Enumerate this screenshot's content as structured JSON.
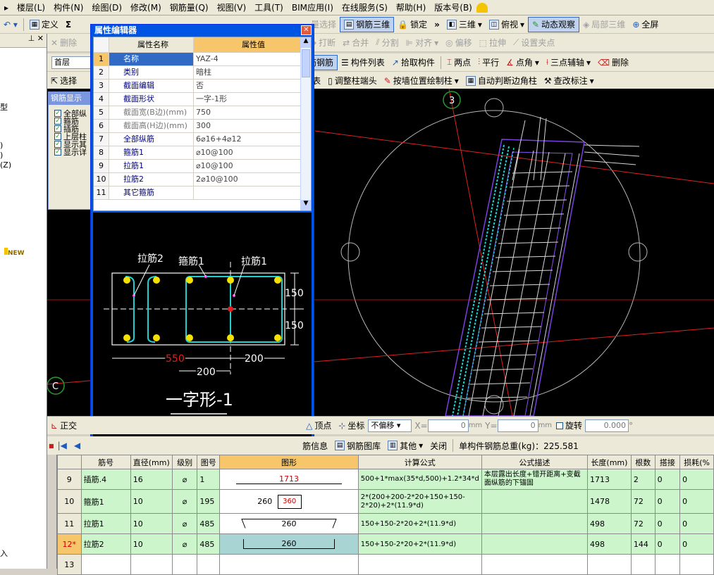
{
  "menubar": [
    "楼层(L)",
    "构件(N)",
    "绘图(D)",
    "修改(M)",
    "钢筋量(Q)",
    "视图(V)",
    "工具(T)",
    "BIM应用(I)",
    "在线服务(S)",
    "帮助(H)",
    "版本号(B)"
  ],
  "toolbar1": {
    "define": "定义",
    "sigma": "Σ",
    "batch_select": "量选择",
    "rebar_3d": "钢筋三维",
    "lock": "锁定",
    "view_3d": "三维",
    "top_view": "俯视",
    "dynamic_observe": "动态观察",
    "partial_3d": "局部三维",
    "fullscreen": "全屏"
  },
  "toolbar2": {
    "delete": "删除",
    "break": "打断",
    "merge": "合并",
    "split": "分割",
    "align": "对齐",
    "offset": "偏移",
    "stretch": "拉伸",
    "set_pinch": "设置夹点"
  },
  "toolbar3": {
    "floor": "首层",
    "rebar_edit": "筋钢筋",
    "component_list": "构件列表",
    "pick_component": "拾取构件",
    "two_points": "两点",
    "parallel": "平行",
    "point_angle": "点角",
    "three_point_aux": "三点辅轴",
    "delete": "删除"
  },
  "toolbar4": {
    "select": "选择",
    "unit_column": "元柱表",
    "adjust_column_end": "调整柱端头",
    "draw_by_wall": "按墙位置绘制柱",
    "auto_corner": "自动判断边角柱",
    "check_label": "查改标注"
  },
  "leftpane": {
    "item1": "型",
    "item2": "(Z)",
    "new_badge": "NEW",
    "bottom": "入"
  },
  "rebar_panel": {
    "title": "钢筋显示",
    "items": [
      "全部纵",
      "箍筋",
      "插筋",
      "上层柱",
      "显示其",
      "显示详"
    ]
  },
  "prop_editor": {
    "title": "属性编辑器",
    "header_name": "属性名称",
    "header_value": "属性值",
    "rows": [
      {
        "n": "1",
        "k": "名称",
        "v": "YAZ-4"
      },
      {
        "n": "2",
        "k": "类别",
        "v": "暗柱"
      },
      {
        "n": "3",
        "k": "截面编辑",
        "v": "否"
      },
      {
        "n": "4",
        "k": "截面形状",
        "v": "一字-1形"
      },
      {
        "n": "5",
        "k": "截面宽(B边)(mm)",
        "v": "750"
      },
      {
        "n": "6",
        "k": "截面高(H边)(mm)",
        "v": "300"
      },
      {
        "n": "7",
        "k": "全部纵筋",
        "v": "6⌀16+4⌀12"
      },
      {
        "n": "8",
        "k": "箍筋1",
        "v": "⌀10@100"
      },
      {
        "n": "9",
        "k": "拉筋1",
        "v": "⌀10@100"
      },
      {
        "n": "10",
        "k": "拉筋2",
        "v": "2⌀10@100"
      },
      {
        "n": "11",
        "k": "其它箍筋",
        "v": ""
      }
    ]
  },
  "section_drawing": {
    "label_tie2": "拉筋2",
    "label_stirrup1": "箍筋1",
    "label_tie1": "拉筋1",
    "dim_150a": "150",
    "dim_150b": "150",
    "dim_550": "550",
    "dim_200a": "200",
    "dim_200b": "200",
    "caption": "一字形-1"
  },
  "viewport": {
    "axis_3": "3",
    "axis_c": "C"
  },
  "statusbar": {
    "ortho": "正交",
    "vertex": "顶点",
    "coord": "坐标",
    "no_offset": "不偏移",
    "x_label": "X=",
    "x_value": "0",
    "y_label": "Y=",
    "y_value": "0",
    "mm1": "mm",
    "mm2": "mm",
    "rotate": "旋转",
    "rotate_value": "0.000",
    "deg": "°"
  },
  "grid_toolbar": {
    "info": "筋信息",
    "library": "钢筋图库",
    "other": "其他",
    "close": "关闭",
    "total": "单构件钢筋总重(kg)：225.581"
  },
  "grid": {
    "headers": [
      "筋号",
      "直径(mm)",
      "级别",
      "图号",
      "图形",
      "计算公式",
      "公式描述",
      "长度(mm)",
      "根数",
      "搭接",
      "损耗(%"
    ],
    "rows": [
      {
        "num": "9",
        "name": "插筋.4",
        "dia": "16",
        "grade": "⌀",
        "fig": "1",
        "shape_label": "1713",
        "formula": "500+1*max(35*d,500)+1.2*34*d",
        "desc": "本层露出长度+错开距离+变截面纵筋的下锚固",
        "len": "1713",
        "count": "2",
        "lap": "0",
        "loss": "0"
      },
      {
        "num": "10",
        "name": "箍筋1",
        "dia": "10",
        "grade": "⌀",
        "fig": "195",
        "shape_a": "260",
        "shape_b": "360",
        "formula": "2*(200+200-2*20+150+150-2*20)+2*(11.9*d)",
        "desc": "",
        "len": "1478",
        "count": "72",
        "lap": "0",
        "loss": "0"
      },
      {
        "num": "11",
        "name": "拉筋1",
        "dia": "10",
        "grade": "⌀",
        "fig": "485",
        "shape_label": "260",
        "formula": "150+150-2*20+2*(11.9*d)",
        "desc": "",
        "len": "498",
        "count": "72",
        "lap": "0",
        "loss": "0"
      },
      {
        "num": "12*",
        "name": "拉筋2",
        "dia": "10",
        "grade": "⌀",
        "fig": "485",
        "shape_label": "260",
        "formula": "150+150-2*20+2*(11.9*d)",
        "desc": "",
        "len": "498",
        "count": "144",
        "lap": "0",
        "loss": "0"
      },
      {
        "num": "13",
        "name": "",
        "dia": "",
        "grade": "",
        "fig": "",
        "shape_label": "",
        "formula": "",
        "desc": "",
        "len": "",
        "count": "",
        "lap": "",
        "loss": ""
      }
    ]
  }
}
